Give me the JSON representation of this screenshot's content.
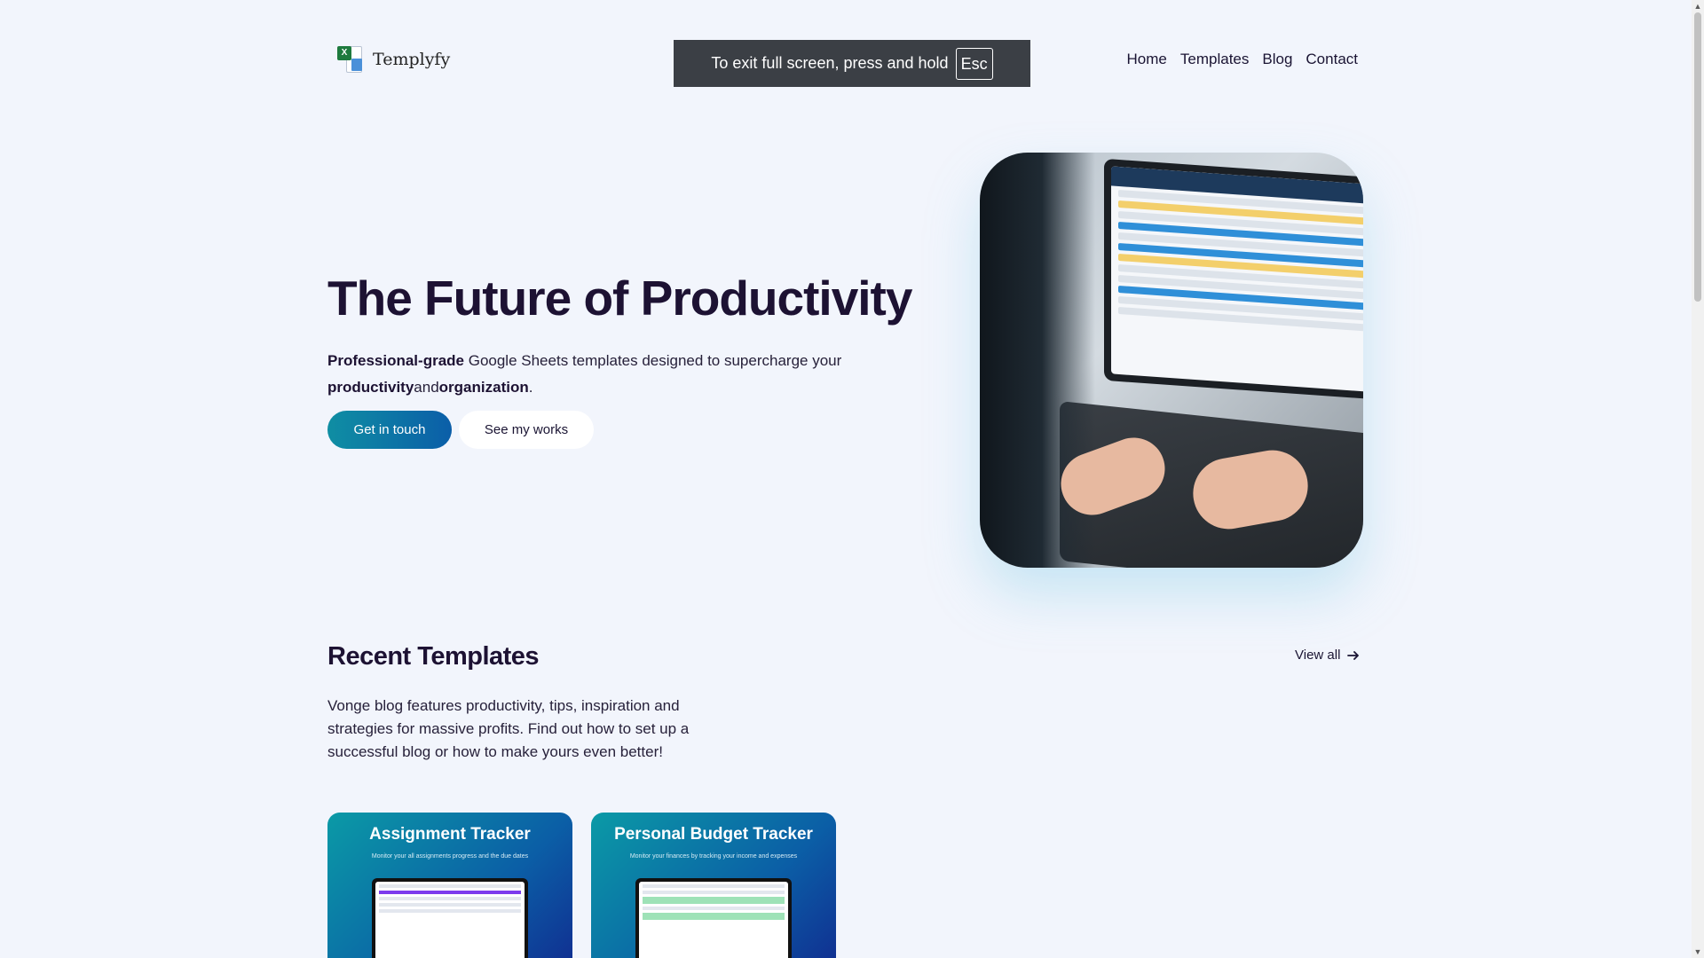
{
  "header": {
    "logo_text": "Templyfy",
    "logo_icon": "spreadsheet-logo-icon",
    "nav": [
      "Home",
      "Templates",
      "Blog",
      "Contact"
    ]
  },
  "fullscreen_notice": {
    "text": "To exit full screen, press and hold",
    "key": "Esc"
  },
  "hero": {
    "title": "The Future of Productivity",
    "subtitle": {
      "bold1": "Professional-grade",
      "text1": " Google Sheets templates designed to supercharge your ",
      "bold2": "productivity",
      "text2": "and",
      "bold3": "organization",
      "text3": "."
    },
    "primary_button": "Get in touch",
    "secondary_button": "See my works",
    "image": "person-typing-on-laptop-photo"
  },
  "recent": {
    "title": "Recent Templates",
    "view_all": "View all",
    "description": "Vonge blog features productivity, tips, inspiration and strategies for massive profits. Find out how to set up a successful blog or how to make yours even better!",
    "cards": [
      {
        "title": "Assignment Tracker",
        "subtitle": "Monitor your all assignments progress and\nthe due dates"
      },
      {
        "title": "Personal Budget Tracker",
        "subtitle": "Monitor your finances by tracking your\nincome and expenses"
      }
    ]
  },
  "colors": {
    "background": "#f2f5fc",
    "primary_gradient_start": "#0f8ea3",
    "primary_gradient_end": "#0b5ea8",
    "heading": "#1d1233"
  }
}
